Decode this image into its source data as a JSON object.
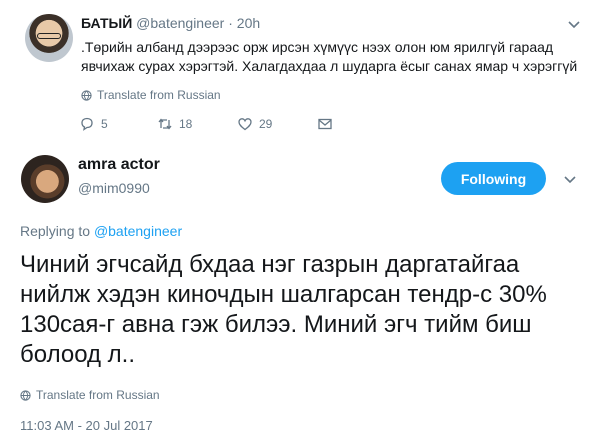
{
  "parent_tweet": {
    "author_name": "БАТЫЙ",
    "handle": "@batengineer",
    "separator": " · ",
    "time": "20h",
    "text": ".Төрийн албанд дээрээс орж ирсэн хүмүүс нээх олон юм ярилгүй гараад явчихаж сурах хэрэгтэй. Халагдахдаа л шударга ёсыг санах ямар ч хэрэггүй",
    "translate_label": "Translate from Russian",
    "actions": {
      "reply_count": "5",
      "retweet_count": "18",
      "like_count": "29"
    }
  },
  "main_tweet": {
    "author_name": "amra actor",
    "handle": "@mim0990",
    "follow_label": "Following",
    "replying_prefix": "Replying to ",
    "replying_mention": "@batengineer",
    "text": "Чиний эгчсайд бхдаа нэг газрын даргатайгаа нийлж хэдэн киночдын шалгарсан тендр-с 30% 130сая-г авна гэж билээ. Миний эгч тийм биш болоод л..",
    "translate_label": "Translate from Russian",
    "timestamp": "11:03 AM - 20 Jul 2017"
  },
  "colors": {
    "accent": "#1da1f2",
    "secondary_text": "#657786",
    "primary_text": "#14171a"
  },
  "icons": [
    "globe-icon",
    "reply-icon",
    "retweet-icon",
    "like-icon",
    "direct-message-icon",
    "chevron-down-icon"
  ]
}
